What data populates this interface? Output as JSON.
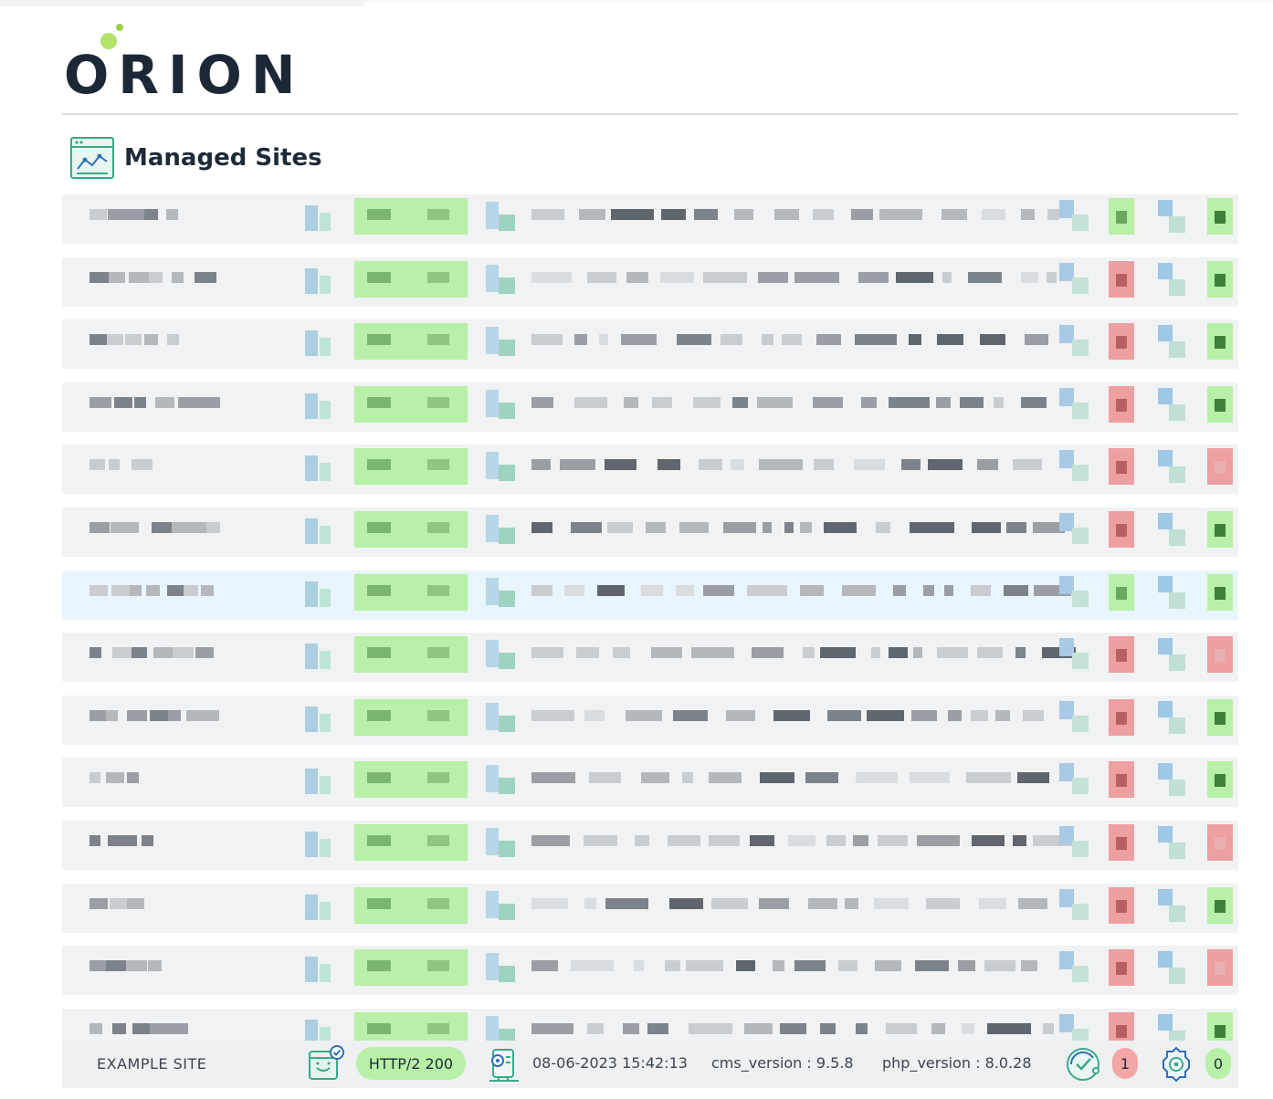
{
  "brand": {
    "name": "ORION"
  },
  "page": {
    "title": "Managed Sites"
  },
  "colors": {
    "brand_dark": "#1c2836",
    "brand_accent": "#b5e36a",
    "status_ok": "#b7f0a6",
    "status_error": "#f3a6a6",
    "row_bg": "#f1f2f3",
    "row_highlight": "#e8f5fc"
  },
  "icons": {
    "header": "site-analytics-icon",
    "row_site": "site-check-icon",
    "row_server": "server-pulse-icon",
    "row_updates": "check-cycle-icon",
    "row_settings": "gear-icon"
  },
  "example_site": {
    "name": "EXAMPLE SITE",
    "status": "HTTP/2 200",
    "timestamp": "08-06-2023 15:42:13",
    "cms_version": "cms_version : 9.5.8",
    "php_version": "php_version : 8.0.28",
    "alerts_count": "1",
    "pending_count": "0"
  }
}
